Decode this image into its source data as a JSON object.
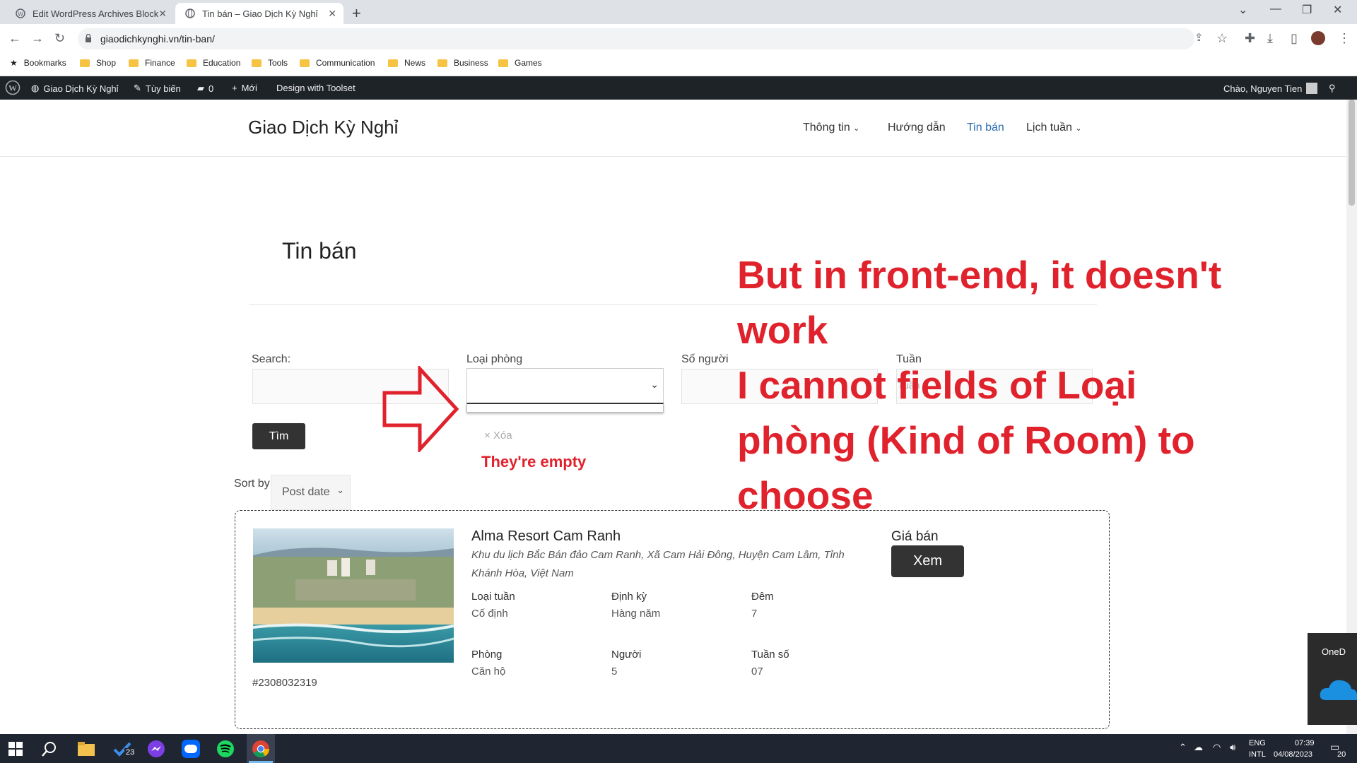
{
  "browser": {
    "tabs": [
      {
        "title": "Edit WordPress Archives Block \"T",
        "active": false
      },
      {
        "title": "Tin bán – Giao Dịch Kỳ Nghỉ",
        "active": true
      }
    ],
    "url": "giaodichkynghi.vn/tin-ban/",
    "bookmarks": [
      "Bookmarks",
      "Shop",
      "Finance",
      "Education",
      "Tools",
      "Communication",
      "News",
      "Business",
      "Games"
    ]
  },
  "admin_bar": {
    "site": "Giao Dịch Kỳ Nghỉ",
    "customize": "Tùy biến",
    "comments": "0",
    "new": "Mới",
    "toolset": "Design with Toolset",
    "greeting": "Chào, Nguyen Tien"
  },
  "site": {
    "title": "Giao Dịch Kỳ Nghỉ",
    "menu": [
      "Thông tin",
      "Hướng dẫn",
      "Tin bán",
      "Lịch tuần"
    ]
  },
  "page": {
    "heading": "Tin bán",
    "filters": {
      "search_label": "Search:",
      "loai_label": "Loại phòng",
      "nguoi_label": "Số người",
      "tuan_label": "Tuần",
      "tuan_placeholder": "Tuần"
    },
    "search_button": "Tìm",
    "clear_link": "× Xóa",
    "sort_label": "Sort by",
    "sort_value": "Post date"
  },
  "listing": {
    "name": "Alma Resort Cam Ranh",
    "address": "Khu du lịch Bắc Bán đảo Cam Ranh, Xã Cam Hải Đông, Huyện Cam Lâm, Tỉnh Khánh Hòa, Việt Nam",
    "loai_tuan_label": "Loại tuần",
    "loai_tuan": "Cố định",
    "dinh_ky_label": "Định kỳ",
    "dinh_ky": "Hàng năm",
    "dem_label": "Đêm",
    "dem": "7",
    "phong_label": "Phòng",
    "phong": "Căn hộ",
    "nguoi_label": "Người",
    "nguoi": "5",
    "tuan_so_label": "Tuần số",
    "tuan_so": "07",
    "price_label": "Giá bán",
    "view_button": "Xem",
    "id": "#2308032319"
  },
  "annotations": {
    "empty_note": "They're empty",
    "line1": "But in front-end, it doesn't",
    "line2": "work",
    "line3": "I cannot fields of Loại",
    "line4": "phòng (Kind of Room) to",
    "line5": "choose"
  },
  "onedrive": {
    "label": "OneD"
  },
  "taskbar": {
    "todo_badge": "23",
    "lang1": "ENG",
    "lang2": "INTL",
    "time": "07:39",
    "date": "04/08/2023",
    "notif_count": "20"
  },
  "colors": {
    "accent_red": "#e0222d",
    "admin_bar": "#1d2327",
    "menu_current": "#2a6cb0"
  }
}
